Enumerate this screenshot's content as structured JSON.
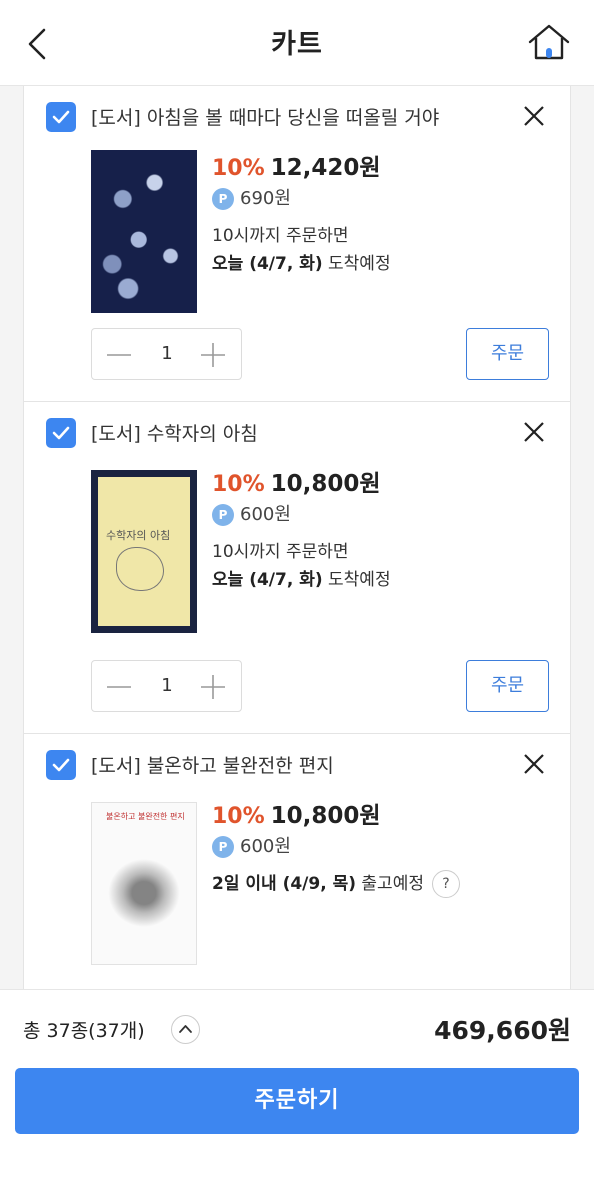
{
  "header": {
    "title": "카트"
  },
  "items": [
    {
      "title": "[도서] 아침을 볼 때마다 당신을 떠올릴 거야",
      "discount": "10%",
      "price": "12,420원",
      "points": "690원",
      "delivery_line1": "10시까지 주문하면",
      "delivery_strong": "오늘 (4/7, 화)",
      "delivery_suffix": " 도착예정",
      "quantity": "1",
      "order_label": "주문"
    },
    {
      "title": "[도서] 수학자의 아침",
      "discount": "10%",
      "price": "10,800원",
      "points": "600원",
      "delivery_line1": "10시까지 주문하면",
      "delivery_strong": "오늘 (4/7, 화)",
      "delivery_suffix": " 도착예정",
      "quantity": "1",
      "order_label": "주문",
      "cover_title": "수학자의 아침"
    },
    {
      "title": "[도서] 불온하고 불완전한 편지",
      "discount": "10%",
      "price": "10,800원",
      "points": "600원",
      "delivery_strong": "2일 이내 (4/9, 목)",
      "delivery_suffix": " 출고예정",
      "help": "?",
      "cover_title": "불온하고 불완전한 편지"
    }
  ],
  "footer": {
    "total_count": "총 37종(37개)",
    "total_price": "469,660원",
    "checkout_label": "주문하기"
  },
  "icons": {
    "point": "P"
  },
  "colors": {
    "accent": "#3d86f0",
    "discount": "#e0542c",
    "order_border": "#3d7ddb",
    "point_badge": "#7fb3ea"
  }
}
